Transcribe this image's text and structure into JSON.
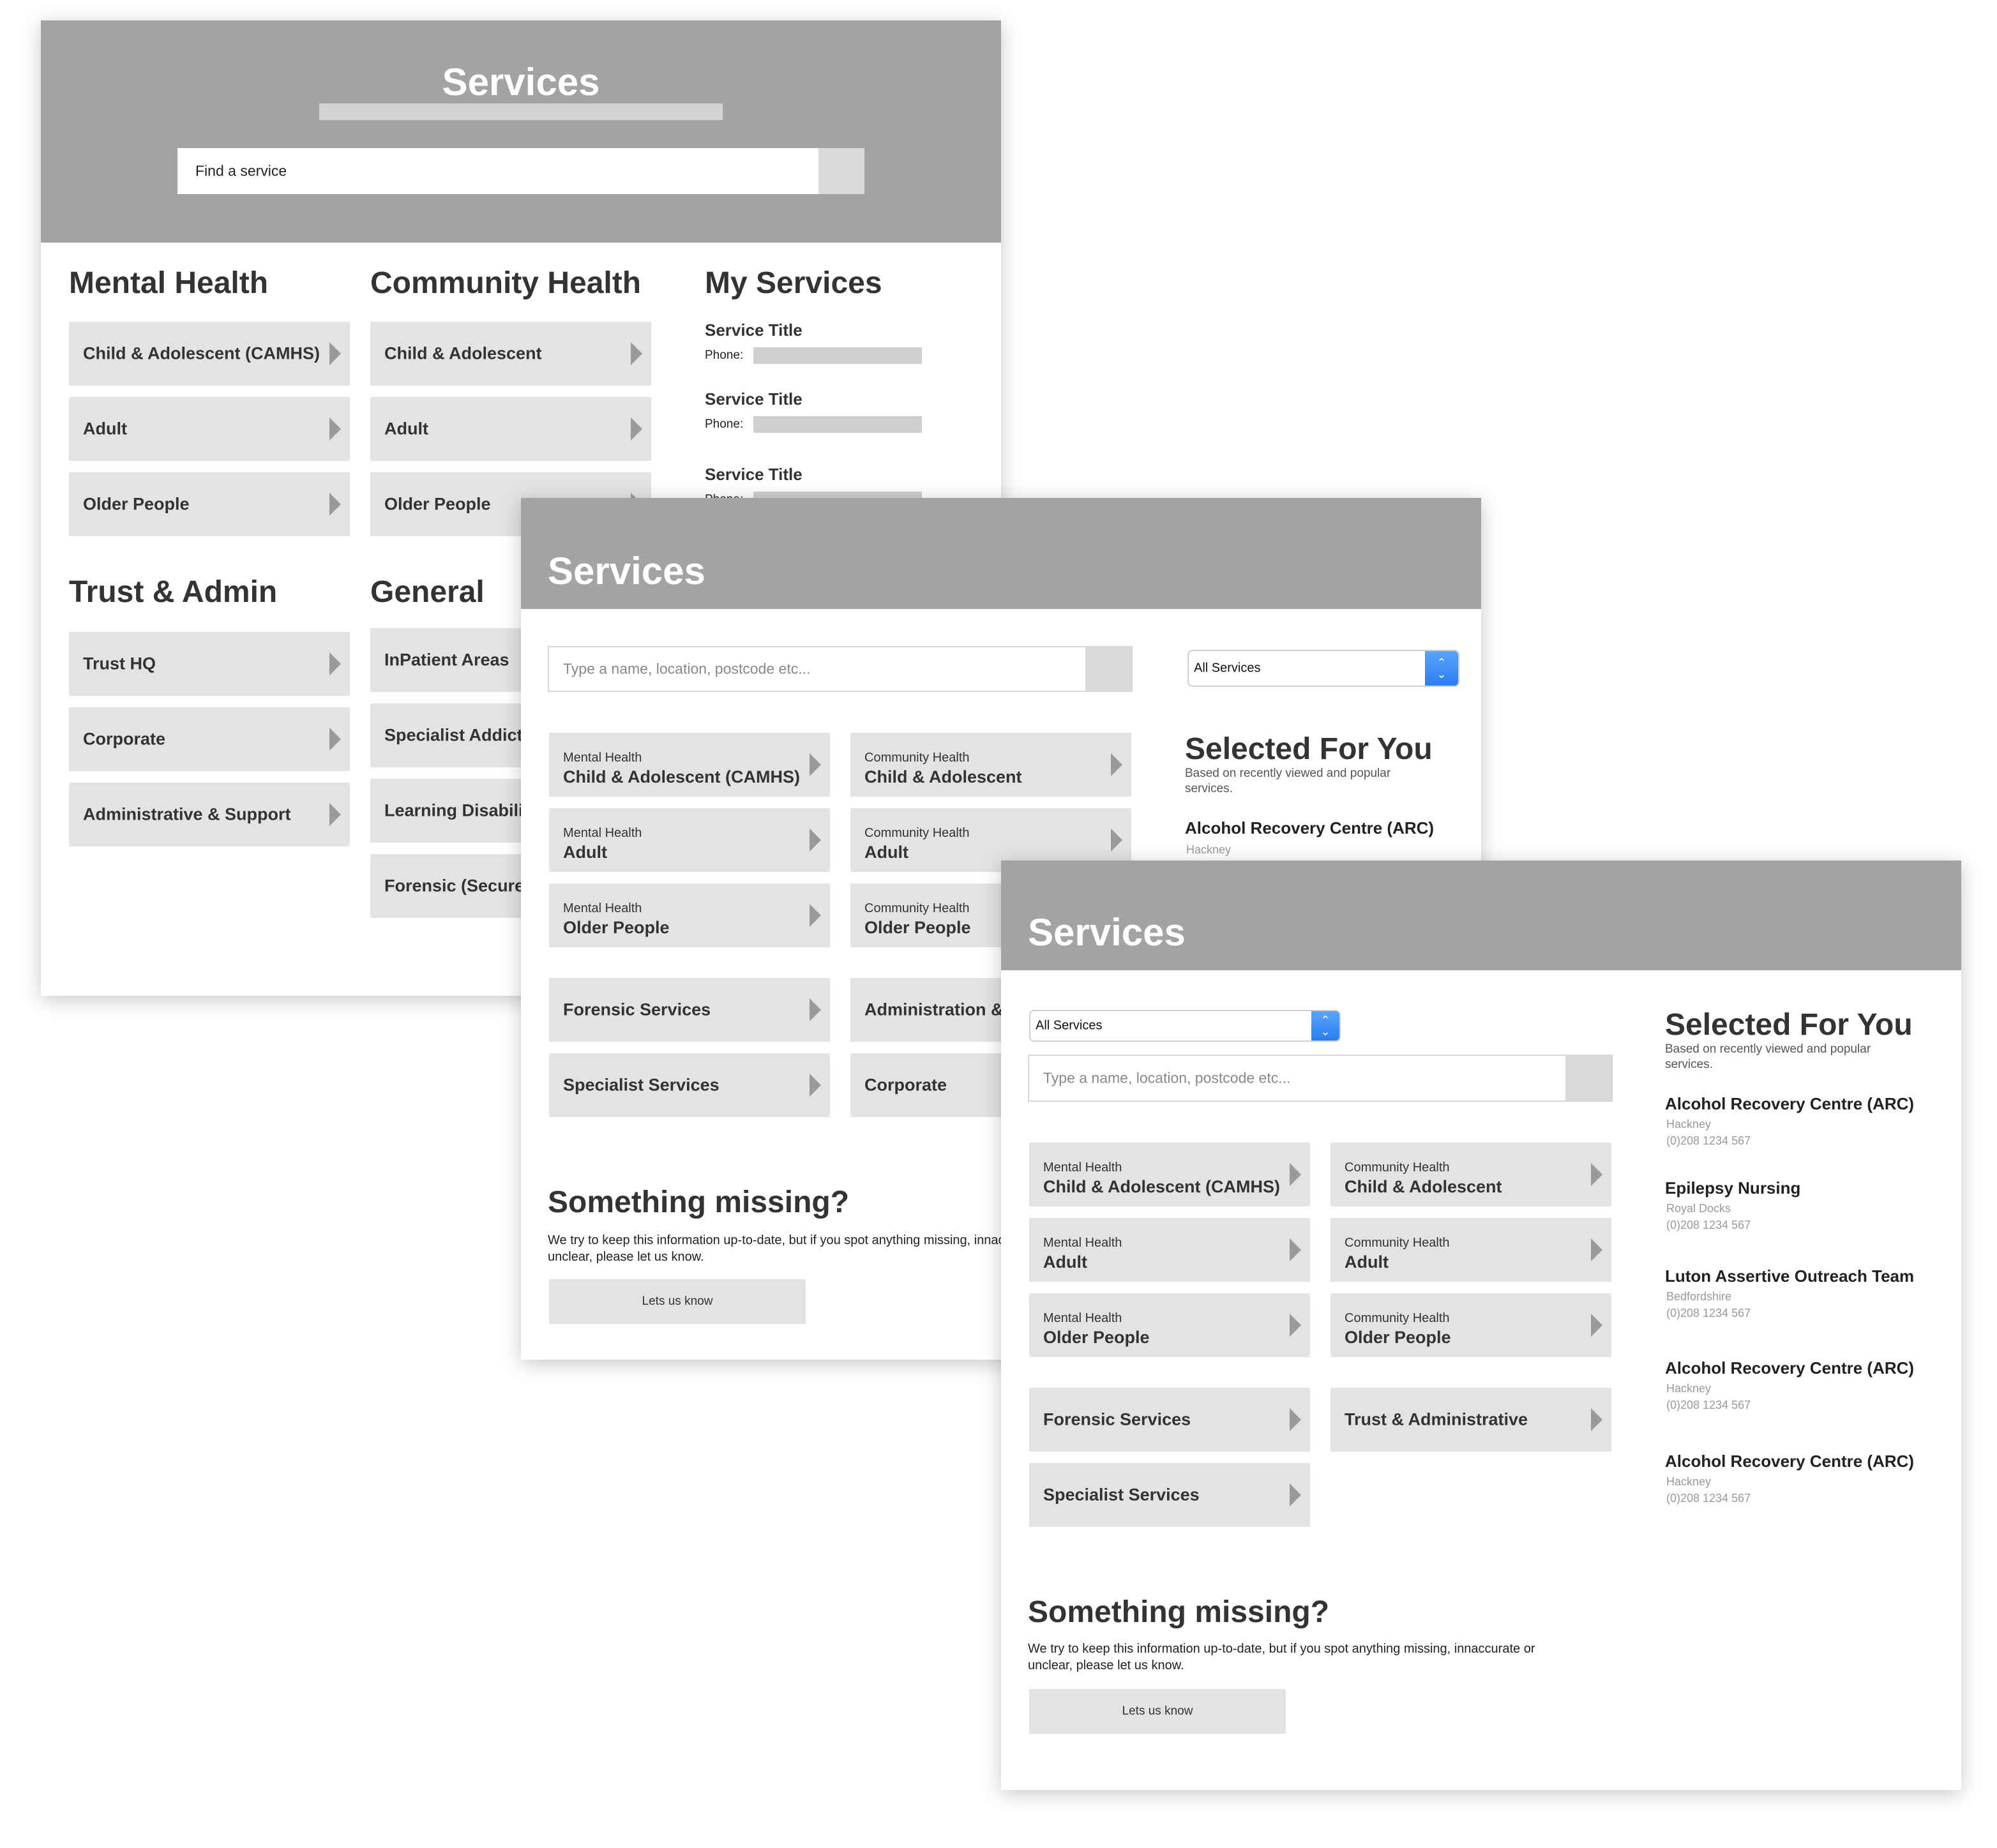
{
  "card1": {
    "title": "Services",
    "search_placeholder": "Find a service",
    "mental_health": {
      "heading": "Mental Health",
      "items": [
        {
          "label": "Child & Adolescent (CAMHS)"
        },
        {
          "label": "Adult"
        },
        {
          "label": "Older People"
        }
      ]
    },
    "community_health": {
      "heading": "Community Health",
      "items": [
        {
          "label": "Child & Adolescent"
        },
        {
          "label": "Adult"
        },
        {
          "label": "Older People"
        }
      ]
    },
    "my_services": {
      "heading": "My Services",
      "items": [
        {
          "title": "Service Title",
          "phone_label": "Phone:"
        },
        {
          "title": "Service Title",
          "phone_label": "Phone:"
        },
        {
          "title": "Service Title",
          "phone_label": "Phone:"
        }
      ]
    },
    "trust_admin": {
      "heading": "Trust & Admin",
      "items": [
        {
          "label": "Trust HQ"
        },
        {
          "label": "Corporate"
        },
        {
          "label": "Administrative & Support"
        }
      ]
    },
    "general": {
      "heading": "General",
      "items": [
        {
          "label": "InPatient Areas"
        },
        {
          "label": "Specialist Addict"
        },
        {
          "label": "Learning Disabili"
        },
        {
          "label": "Forensic (Secure"
        }
      ]
    }
  },
  "card2": {
    "title": "Services",
    "search_placeholder": "Type a name, location, postcode etc...",
    "select_value": "All Services",
    "tiles_left": [
      {
        "category": "Mental Health",
        "label": "Child & Adolescent (CAMHS)"
      },
      {
        "category": "Mental Health",
        "label": "Adult"
      },
      {
        "category": "Mental Health",
        "label": "Older People"
      },
      {
        "label": "Forensic Services"
      },
      {
        "label": "Specialist Services"
      }
    ],
    "tiles_right": [
      {
        "category": "Community Health",
        "label": "Child & Adolescent"
      },
      {
        "category": "Community Health",
        "label": "Adult"
      },
      {
        "category": "Community Health",
        "label": "Older People"
      },
      {
        "label": "Administration &"
      },
      {
        "label": "Corporate"
      }
    ],
    "selected": {
      "title": "Selected For You",
      "subtitle": "Based on recently viewed and popular services.",
      "items": [
        {
          "name": "Alcohol Recovery Centre (ARC)",
          "location": "Hackney"
        }
      ]
    },
    "missing": {
      "title": "Something missing?",
      "text": "We try to keep this information up-to-date, but if you spot anything missing, innaccurate or unclear, please let us know.",
      "button": "Lets us know"
    }
  },
  "card3": {
    "title": "Services",
    "select_value": "All Services",
    "search_placeholder": "Type a name, location, postcode etc...",
    "tiles_left": [
      {
        "category": "Mental Health",
        "label": "Child & Adolescent (CAMHS)"
      },
      {
        "category": "Mental Health",
        "label": "Adult"
      },
      {
        "category": "Mental Health",
        "label": "Older People"
      },
      {
        "label": "Forensic Services"
      },
      {
        "label": "Specialist Services"
      }
    ],
    "tiles_right": [
      {
        "category": "Community Health",
        "label": "Child & Adolescent"
      },
      {
        "category": "Community Health",
        "label": "Adult"
      },
      {
        "category": "Community Health",
        "label": "Older People"
      },
      {
        "label": "Trust & Administrative"
      }
    ],
    "selected": {
      "title": "Selected For You",
      "subtitle": "Based on recently viewed and popular services.",
      "items": [
        {
          "name": "Alcohol Recovery Centre (ARC)",
          "location": "Hackney",
          "phone": "(0)208 1234 567"
        },
        {
          "name": "Epilepsy Nursing",
          "location": "Royal Docks",
          "phone": "(0)208 1234 567"
        },
        {
          "name": "Luton Assertive Outreach Team",
          "location": "Bedfordshire",
          "phone": "(0)208 1234 567"
        },
        {
          "name": "Alcohol Recovery Centre (ARC)",
          "location": "Hackney",
          "phone": "(0)208 1234 567"
        },
        {
          "name": "Alcohol Recovery Centre (ARC)",
          "location": "Hackney",
          "phone": "(0)208 1234 567"
        }
      ]
    },
    "missing": {
      "title": "Something missing?",
      "text": "We try to keep this information up-to-date, but if you spot anything missing, innaccurate or unclear, please let us know.",
      "button": "Lets us know"
    }
  },
  "colors": {
    "header": "#a3a3a3",
    "tile": "#e3e3e3",
    "arrow": "#9a9a9a",
    "select_accent": "#2a7ef0"
  },
  "icons": {
    "tile_arrow": "triangle-right-icon",
    "select": "up-down-chevron-icon"
  }
}
